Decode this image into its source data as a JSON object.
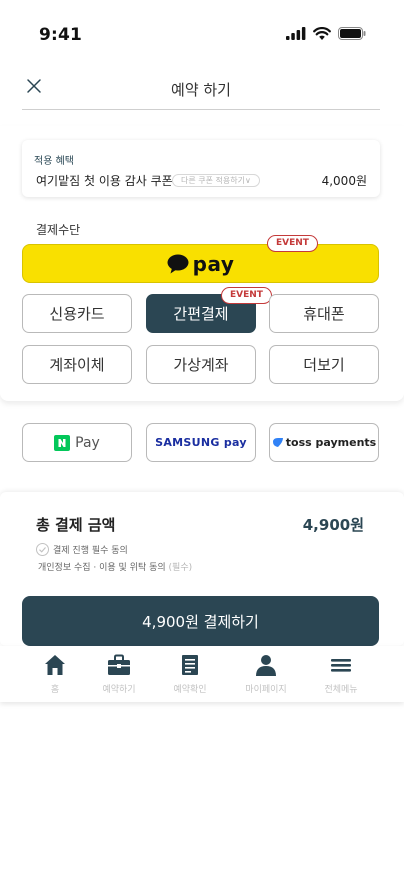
{
  "status_bar": {
    "time": "9:41",
    "icons": [
      "signal-icon",
      "wifi-icon",
      "battery-icon"
    ]
  },
  "header": {
    "title": "예약 하기",
    "close_icon": "close-icon"
  },
  "coupon": {
    "label": "적용 혜택",
    "name": "여기맡짐 첫 이용 감사 쿠폰",
    "other_button": "다른 쿠폰 적용하기∨",
    "amount": "4,000원"
  },
  "payment": {
    "section_label": "결제수단",
    "kakao": {
      "label": "pay",
      "icon": "kakao-bubble-icon",
      "event_badge": "EVENT",
      "brand_color": "#f9e000"
    },
    "methods": [
      {
        "label": "신용카드",
        "selected": false
      },
      {
        "label": "간편결제",
        "selected": true,
        "badge": "EVENT"
      },
      {
        "label": "휴대폰",
        "selected": false
      },
      {
        "label": "계좌이체",
        "selected": false
      },
      {
        "label": "가상계좌",
        "selected": false
      },
      {
        "label": "더보기",
        "selected": false
      }
    ],
    "brands": [
      {
        "label": "Pay",
        "icon": "naver-pay-icon"
      },
      {
        "label": "SAMSUNG pay",
        "icon": "samsung-pay-logo"
      },
      {
        "label": "toss payments",
        "icon": "toss-logo-icon"
      }
    ]
  },
  "total": {
    "label": "총 결제 금액",
    "amount": "4,900원",
    "agree_label": "결제 진행 필수 동의",
    "agree_sub": "개인정보 수집 · 이용 및 위탁 동의",
    "agree_required": "(필수)",
    "submit_label": "4,900원 결제하기"
  },
  "tabbar": {
    "items": [
      {
        "label": "홈",
        "icon": "home-icon"
      },
      {
        "label": "예약하기",
        "icon": "briefcase-icon"
      },
      {
        "label": "예약확인",
        "icon": "document-icon"
      },
      {
        "label": "마이페이지",
        "icon": "person-icon"
      },
      {
        "label": "전체메뉴",
        "icon": "menu-icon"
      }
    ]
  },
  "colors": {
    "primary": "#2b4653",
    "event": "#c43a3a",
    "kakao_yellow": "#f9e000",
    "inactive": "#c2c2c2"
  }
}
